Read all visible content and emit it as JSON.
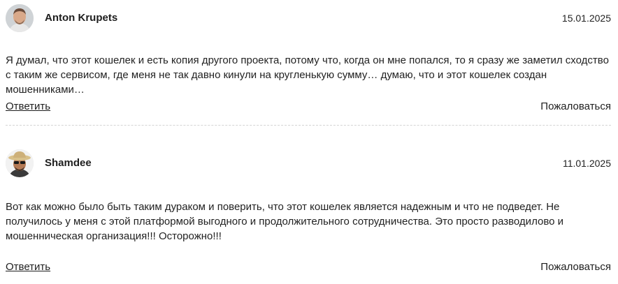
{
  "comments": [
    {
      "author": "Anton Krupets",
      "date": "15.01.2025",
      "text": "Я думал, что этот кошелек и есть копия другого проекта, потому что, когда он мне попался, то я сразу же заметил сходство с таким же сервисом, где меня не так давно кинули на кругленькую сумму… думаю, что и этот кошелек создан мошенниками…",
      "reply_label": "Ответить",
      "report_label": "Пожаловаться"
    },
    {
      "author": "Shamdee",
      "date": "11.01.2025",
      "text": "Вот как можно было быть таким дураком и поверить, что этот кошелек является надежным и что не подведет. Не получилось у меня с этой платформой выгодного и продолжительного сотрудничества. Это просто разводилово и мошенническая организация!!! Осторожно!!!",
      "reply_label": "Ответить",
      "report_label": "Пожаловаться"
    }
  ]
}
